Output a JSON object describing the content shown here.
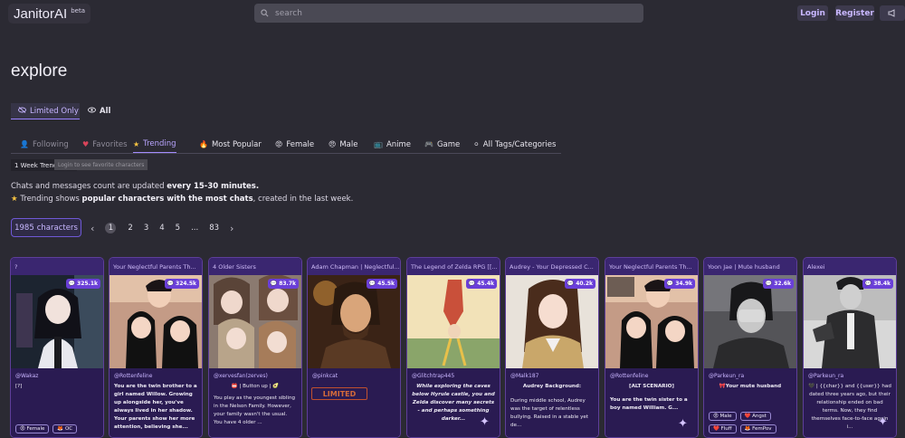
{
  "header": {
    "logo": "JanitorAI",
    "logo_badge": "beta",
    "search_placeholder": "search",
    "login": "Login",
    "register": "Register"
  },
  "page_title": "explore",
  "filters": {
    "limited": "Limited Only",
    "all": "All"
  },
  "tabs": [
    {
      "label": "Following",
      "icon": "user-icon"
    },
    {
      "label": "Favorites",
      "icon": "heart-icon"
    },
    {
      "label": "Trending",
      "icon": "star-icon"
    },
    {
      "label": "Most Popular",
      "icon": "fire-icon"
    },
    {
      "label": "Female",
      "icon": "female-face-icon"
    },
    {
      "label": "Male",
      "icon": "male-face-icon"
    },
    {
      "label": "Anime",
      "icon": "tv-icon"
    },
    {
      "label": "Game",
      "icon": "gamepad-icon"
    },
    {
      "label": "All Tags/Categories",
      "icon": "dot-icon"
    }
  ],
  "sort": {
    "selected": "1 Week Trending",
    "tooltip": "Login to see favorite characters"
  },
  "info": {
    "line1_a": "Chats and messages count are updated ",
    "line1_b": "every 15-30 minutes.",
    "line2_a": " Trending shows ",
    "line2_b": "popular characters with the most chats",
    "line2_c": ", created in the last week."
  },
  "count": {
    "value": "1985",
    "label": "characters"
  },
  "pagination": {
    "pages": [
      "1",
      "2",
      "3",
      "4",
      "5",
      "...",
      "83"
    ],
    "current": "1",
    "prev": "‹",
    "next": "›"
  },
  "cards": [
    {
      "title": "?",
      "chats": "325.1k",
      "author": "@Wakaz",
      "desc": "[?]",
      "tags": [
        "😡 Female",
        "🦊 OC"
      ]
    },
    {
      "title": "Your Neglectful Parents Th...",
      "chats": "324.5k",
      "author": "@Rottenfeline",
      "desc": "You are the twin brother to a girl named Willow. Growing up alongside her, you've always lived in her shadow. Your parents show her more attention, believing she..."
    },
    {
      "title": "4 Older Sisters",
      "chats": "83.7k",
      "author": "@xervesfan(zerves)",
      "desc_top": "📛 | Button up | 🥑",
      "desc": "You play as the youngest sibling in the Nelson Family. However, your family wasn't the usual. You have 4 older ..."
    },
    {
      "title": "Adam Chapman | Neglectful...",
      "chats": "45.5k",
      "author": "@pinkcat",
      "banner": "LIMITED"
    },
    {
      "title": "The Legend of Zelda RPG [[...",
      "chats": "45.4k",
      "author": "@Glitchtrap445",
      "desc": "While exploring the caves below Hyrule castle, you and Zelda discover many secrets - and perhaps something darker..."
    },
    {
      "title": "Audrey - Your Depressed C...",
      "chats": "40.2k",
      "author": "@Malk187",
      "desc_top": "Audrey Background:",
      "desc": "During middle school, Audrey was the target of relentless bullying. Raised in a stable yet de..."
    },
    {
      "title": "Your Neglectful Parents Th...",
      "chats": "34.9k",
      "author": "@Rottenfeline",
      "desc_top": "[ALT SCENARIO]",
      "desc": "You are the twin sister to a boy named William. G..."
    },
    {
      "title": "Yoon Jae | Mute husband",
      "chats": "32.6k",
      "author": "@Parkeun_ra",
      "desc_top": "🎀Your mute husband",
      "tags": [
        "😡 Male",
        "❤️ Angst",
        "❤️ Fluff",
        "🦊 FemPov"
      ]
    },
    {
      "title": "Alexei",
      "chats": "38.4k",
      "author": "@Parkeun_ra",
      "desc": "🖤 | {{char}} and {{user}} had dated three years ago, but their relationship ended on bad terms. Now, they find themselves face-to-face again i..."
    }
  ],
  "colors": {
    "accent": "#9a83ff",
    "card_bg": "#2a1b52",
    "badge": "#6a3fd8",
    "background": "#2b2a33"
  }
}
